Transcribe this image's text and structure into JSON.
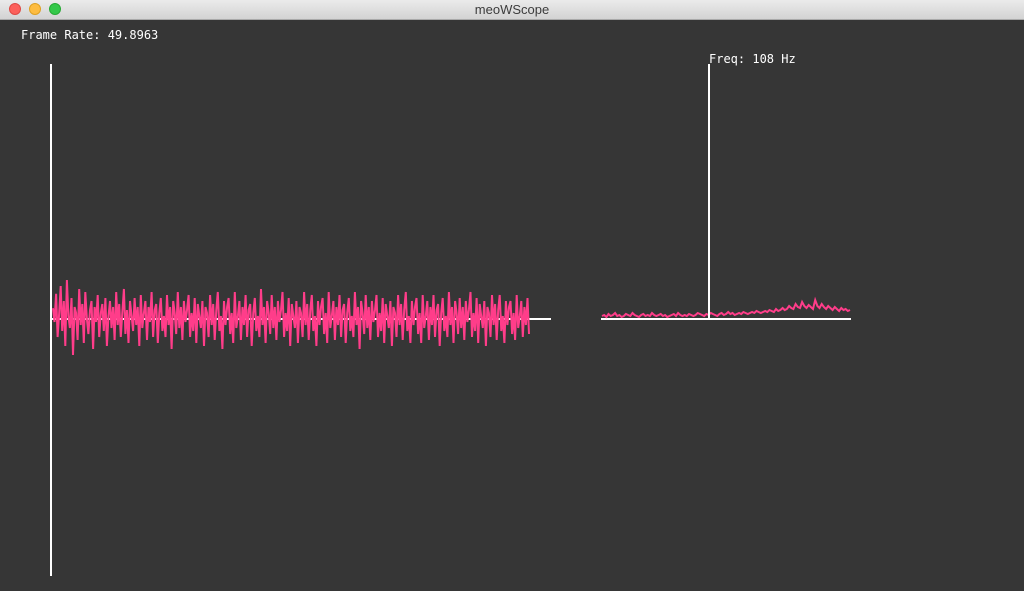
{
  "window": {
    "title": "meoWScope"
  },
  "overlay": {
    "frame_rate_label": "Frame Rate: 49.8963",
    "freq_label": "Freq: 108 Hz"
  },
  "colors": {
    "background": "#363636",
    "axis": "#ffffff",
    "signal": "#ff3d8a"
  },
  "waveform": {
    "samples": [
      0.18,
      -0.05,
      0.42,
      -0.3,
      0.1,
      0.55,
      -0.2,
      0.3,
      -0.45,
      0.65,
      0.05,
      -0.15,
      0.35,
      -0.6,
      0.2,
      0.1,
      -0.35,
      0.5,
      -0.1,
      0.25,
      -0.4,
      0.45,
      0.0,
      -0.25,
      0.15,
      0.3,
      -0.5,
      0.2,
      -0.05,
      0.4,
      -0.3,
      0.1,
      0.25,
      -0.2,
      0.35,
      -0.45,
      0.05,
      0.3,
      -0.15,
      0.2,
      -0.35,
      0.45,
      -0.1,
      0.25,
      -0.3,
      0.1,
      0.5,
      -0.25,
      0.15,
      -0.4,
      0.3,
      0.05,
      -0.2,
      0.35,
      -0.1,
      0.2,
      -0.45,
      0.4,
      -0.15,
      0.1,
      0.3,
      -0.35,
      0.2,
      -0.05,
      0.45,
      -0.3,
      0.15,
      0.25,
      -0.4,
      0.1,
      0.35,
      -0.2,
      0.05,
      -0.3,
      0.4,
      -0.1,
      0.2,
      -0.5,
      0.3,
      0.1,
      -0.25,
      0.45,
      -0.15,
      0.2,
      -0.35,
      0.3,
      -0.05,
      0.15,
      0.4,
      -0.3,
      0.1,
      -0.2,
      0.35,
      -0.4,
      0.25,
      0.05,
      -0.15,
      0.3,
      -0.45,
      0.2,
      0.1,
      -0.3,
      0.4,
      -0.1,
      0.25,
      -0.35,
      0.15,
      0.45,
      -0.2,
      0.05,
      -0.5,
      0.3,
      -0.1,
      0.2,
      0.35,
      -0.25,
      0.1,
      -0.4,
      0.45,
      -0.15,
      0.05,
      0.3,
      -0.35,
      0.2,
      -0.1,
      0.4,
      -0.3,
      0.15,
      0.25,
      -0.45,
      0.1,
      0.35,
      -0.2,
      0.05,
      -0.3,
      0.5,
      -0.1,
      0.2,
      -0.4,
      0.3,
      0.1,
      -0.25,
      0.4,
      -0.15,
      0.2,
      -0.35,
      0.3,
      -0.05,
      0.15,
      0.45,
      -0.3,
      0.1,
      -0.2,
      0.35,
      -0.45,
      0.25,
      0.05,
      -0.15,
      0.3,
      -0.4,
      0.2,
      0.1,
      -0.3,
      0.45,
      -0.1,
      0.25,
      -0.35,
      0.15,
      0.4,
      -0.2,
      0.05,
      -0.45,
      0.3,
      -0.1,
      0.2,
      0.35,
      -0.25,
      0.1,
      -0.4,
      0.45,
      -0.15,
      0.05,
      0.3,
      -0.35,
      0.2,
      -0.1,
      0.4,
      -0.3,
      0.15,
      0.25,
      -0.4,
      0.1,
      0.35,
      -0.2,
      0.05,
      -0.3,
      0.45,
      -0.1,
      0.2,
      -0.5,
      0.3,
      0.1,
      -0.25,
      0.4,
      -0.15,
      0.2,
      -0.35,
      0.3,
      -0.05,
      0.15,
      0.4,
      -0.3,
      0.1,
      -0.2,
      0.35,
      -0.4,
      0.25,
      0.05,
      -0.15,
      0.3,
      -0.45,
      0.2,
      0.1,
      -0.3,
      0.4,
      -0.1,
      0.25,
      -0.35,
      0.15,
      0.45,
      -0.2,
      0.05,
      -0.4,
      0.3,
      -0.1,
      0.2,
      0.35,
      -0.25,
      0.1,
      -0.4,
      0.4,
      -0.15,
      0.05,
      0.3,
      -0.35,
      0.2,
      -0.1,
      0.4,
      -0.3,
      0.15,
      0.25,
      -0.45,
      0.1,
      0.35,
      -0.2,
      0.05,
      -0.3,
      0.45,
      -0.1,
      0.2,
      -0.4,
      0.3,
      0.1,
      -0.25,
      0.35,
      -0.15,
      0.2,
      -0.35,
      0.3,
      -0.05,
      0.15,
      0.45,
      -0.3,
      0.1,
      -0.2,
      0.35,
      -0.4,
      0.25,
      0.05,
      -0.15,
      0.3,
      -0.45,
      0.2,
      0.1,
      -0.3,
      0.4,
      -0.1,
      0.25,
      -0.35,
      0.15,
      0.4,
      -0.2,
      0.05,
      -0.4,
      0.3,
      -0.1,
      0.2,
      0.3,
      -0.25,
      0.1,
      -0.35,
      0.4,
      -0.15,
      0.05,
      0.3,
      -0.3,
      0.2,
      -0.1,
      0.35,
      -0.25
    ]
  },
  "spectrum": {
    "bins": [
      0.02,
      0.03,
      0.01,
      0.04,
      0.02,
      0.03,
      0.05,
      0.02,
      0.03,
      0.01,
      0.02,
      0.04,
      0.03,
      0.02,
      0.05,
      0.03,
      0.02,
      0.01,
      0.03,
      0.04,
      0.02,
      0.03,
      0.02,
      0.05,
      0.03,
      0.02,
      0.03,
      0.04,
      0.02,
      0.03,
      0.01,
      0.02,
      0.03,
      0.04,
      0.02,
      0.05,
      0.03,
      0.02,
      0.03,
      0.02,
      0.04,
      0.03,
      0.02,
      0.03,
      0.05,
      0.04,
      0.03,
      0.02,
      0.04,
      0.03,
      0.05,
      0.04,
      0.03,
      0.02,
      0.04,
      0.05,
      0.03,
      0.04,
      0.06,
      0.04,
      0.05,
      0.03,
      0.04,
      0.05,
      0.04,
      0.06,
      0.05,
      0.04,
      0.05,
      0.06,
      0.05,
      0.07,
      0.06,
      0.05,
      0.06,
      0.07,
      0.06,
      0.08,
      0.07,
      0.06,
      0.09,
      0.07,
      0.08,
      0.1,
      0.08,
      0.09,
      0.12,
      0.1,
      0.09,
      0.14,
      0.11,
      0.1,
      0.16,
      0.12,
      0.1,
      0.13,
      0.11,
      0.09,
      0.18,
      0.12,
      0.1,
      0.14,
      0.11,
      0.09,
      0.12,
      0.1,
      0.08,
      0.11,
      0.09,
      0.07,
      0.1,
      0.08,
      0.09,
      0.07,
      0.08
    ]
  }
}
